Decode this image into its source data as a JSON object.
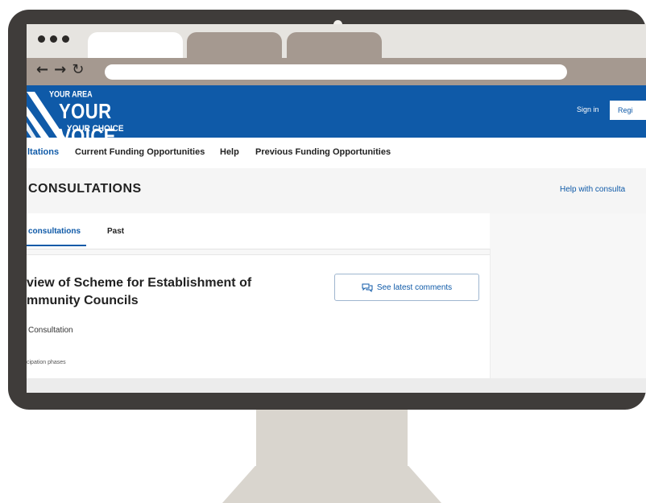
{
  "browser": {
    "tabs": [
      "",
      "",
      ""
    ],
    "nav_icons": {
      "back": "back-arrow-icon",
      "forward": "forward-arrow-icon",
      "reload": "reload-icon"
    },
    "url": ""
  },
  "site": {
    "logo": {
      "small": "YOUR AREA",
      "main": "YOUR VOICE",
      "sub": "YOUR CHOICE"
    },
    "signin": "Sign in",
    "register": "Regi",
    "brand_color": "#0f5aa8"
  },
  "nav": {
    "items": [
      "ltations",
      "Current Funding Opportunities",
      "Help",
      "Previous Funding Opportunities"
    ]
  },
  "page": {
    "title": "CONSULTATIONS",
    "help_link": "Help with consulta"
  },
  "subtabs": [
    "consultations",
    "Past"
  ],
  "card": {
    "title_line1": "view of Scheme for Establishment of",
    "title_line2": "mmunity Councils",
    "comments_button": "See latest comments",
    "type": "Consultation",
    "phases_label": "cipation phases"
  }
}
